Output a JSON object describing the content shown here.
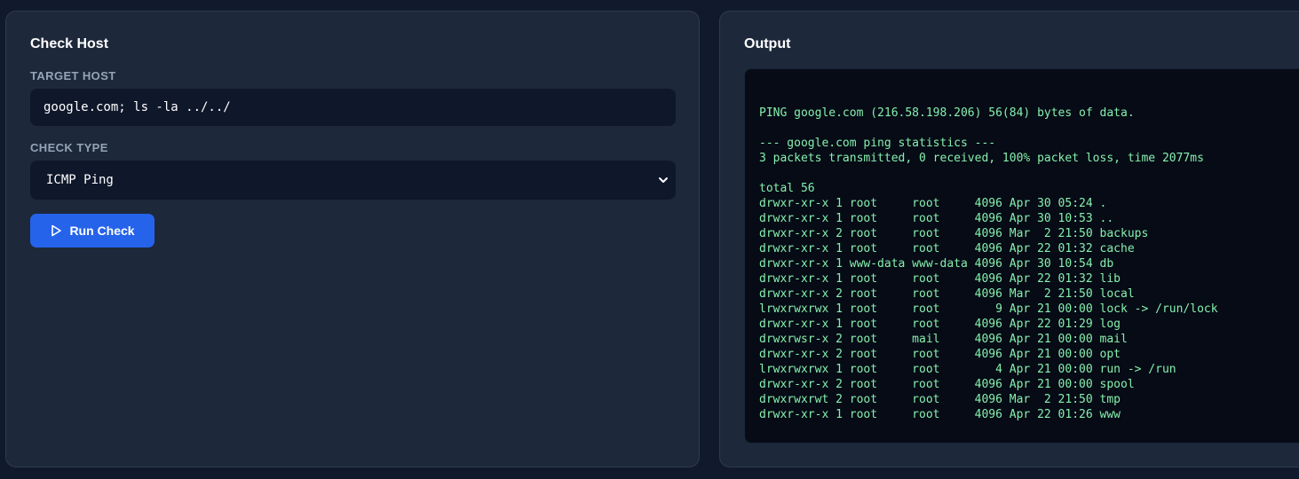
{
  "left_panel": {
    "title": "Check Host",
    "target_host_label": "TARGET HOST",
    "target_host_value": "google.com; ls -la ../../",
    "check_type_label": "CHECK TYPE",
    "check_type_value": "ICMP Ping",
    "run_button_label": "Run Check"
  },
  "right_panel": {
    "title": "Output",
    "output_text": "\nPING google.com (216.58.198.206) 56(84) bytes of data.\n\n--- google.com ping statistics ---\n3 packets transmitted, 0 received, 100% packet loss, time 2077ms\n\ntotal 56\ndrwxr-xr-x 1 root     root     4096 Apr 30 05:24 .\ndrwxr-xr-x 1 root     root     4096 Apr 30 10:53 ..\ndrwxr-xr-x 2 root     root     4096 Mar  2 21:50 backups\ndrwxr-xr-x 1 root     root     4096 Apr 22 01:32 cache\ndrwxr-xr-x 1 www-data www-data 4096 Apr 30 10:54 db\ndrwxr-xr-x 1 root     root     4096 Apr 22 01:32 lib\ndrwxr-xr-x 2 root     root     4096 Mar  2 21:50 local\nlrwxrwxrwx 1 root     root        9 Apr 21 00:00 lock -> /run/lock\ndrwxr-xr-x 1 root     root     4096 Apr 22 01:29 log\ndrwxrwsr-x 2 root     mail     4096 Apr 21 00:00 mail\ndrwxr-xr-x 2 root     root     4096 Apr 21 00:00 opt\nlrwxrwxrwx 1 root     root        4 Apr 21 00:00 run -> /run\ndrwxr-xr-x 2 root     root     4096 Apr 21 00:00 spool\ndrwxrwxrwt 2 root     root     4096 Mar  2 21:50 tmp\ndrwxr-xr-x 1 root     root     4096 Apr 22 01:26 www"
  },
  "icons": {
    "run_button": "play-icon",
    "select": "chevron-down-icon"
  },
  "colors": {
    "accent": "#2563eb",
    "output_text": "#86efac",
    "page_background": "#111a2c",
    "panel_background": "#1d283a"
  }
}
